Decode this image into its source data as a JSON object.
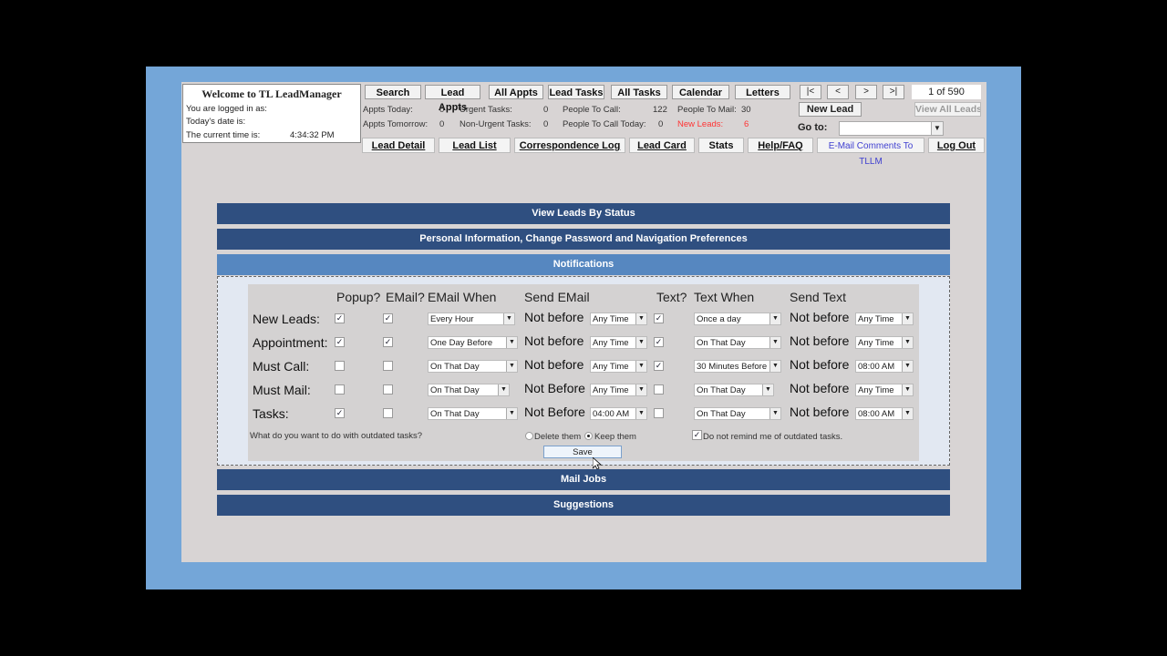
{
  "welcome": {
    "title": "Welcome to TL LeadManager",
    "logged_in_label": "You are logged in as:",
    "date_label": "Today's date is:",
    "time_label": "The current time is:",
    "time_value": "4:34:32 PM"
  },
  "top_nav": {
    "search": "Search",
    "lead_appts": "Lead Appts",
    "all_appts": "All Appts",
    "lead_tasks": "Lead Tasks",
    "all_tasks": "All Tasks",
    "calendar": "Calendar",
    "letters": "Letters",
    "first": "|<",
    "prev": "<",
    "next": ">",
    "last": ">|",
    "pager": "1 of 590",
    "new_lead": "New Lead",
    "view_all_leads": "View All Leads",
    "goto_label": "Go to:"
  },
  "stats": {
    "appts_today_label": "Appts Today:",
    "appts_today": "0",
    "urgent_tasks_label": "Urgent Tasks:",
    "urgent_tasks": "0",
    "people_to_call_label": "People To Call:",
    "people_to_call": "122",
    "people_to_mail_label": "People To Mail:",
    "people_to_mail": "30",
    "appts_tomorrow_label": "Appts Tomorrow:",
    "appts_tomorrow": "0",
    "non_urgent_tasks_label": "Non-Urgent Tasks:",
    "non_urgent_tasks": "0",
    "people_to_call_today_label": "People To Call Today:",
    "people_to_call_today": "0",
    "new_leads_label": "New Leads:",
    "new_leads": "6",
    "new_leads_color": "#ff3333"
  },
  "tabs2": {
    "lead_detail": "Lead Detail",
    "lead_list": "Lead List",
    "correspondence_log": "Correspondence Log",
    "lead_card": "Lead Card",
    "stats": "Stats",
    "help_faq": "Help/FAQ",
    "email_comments": "E-Mail Comments To TLLM",
    "log_out": "Log Out"
  },
  "sections": {
    "view_leads_by_status": "View Leads By Status",
    "personal_info": "Personal Information, Change Password and Navigation Preferences",
    "notifications": "Notifications",
    "mail_jobs": "Mail Jobs",
    "suggestions": "Suggestions"
  },
  "notifications": {
    "headers": {
      "popup": "Popup?",
      "email": "EMail?",
      "email_when": "EMail When",
      "send_email": "Send EMail",
      "text": "Text?",
      "text_when": "Text When",
      "send_text": "Send Text"
    },
    "rows": [
      {
        "label": "New Leads:",
        "popup": true,
        "email": true,
        "email_when": "Every Hour",
        "email_nb": "Not before",
        "email_time": "Any Time",
        "text": true,
        "text_when": "Once a day",
        "text_nb": "Not before",
        "text_time": "Any Time"
      },
      {
        "label": "Appointment:",
        "popup": true,
        "email": true,
        "email_when": "One Day Before",
        "email_nb": "Not before",
        "email_time": "Any Time",
        "text": true,
        "text_when": "On That Day",
        "text_nb": "Not before",
        "text_time": "Any Time"
      },
      {
        "label": "Must Call:",
        "popup": false,
        "email": false,
        "email_when": "On That Day",
        "email_nb": "Not before",
        "email_time": "Any Time",
        "text": true,
        "text_when": "30 Minutes Before",
        "text_nb": "Not before",
        "text_time": "08:00 AM"
      },
      {
        "label": "Must Mail:",
        "popup": false,
        "email": false,
        "email_when": "On That Day",
        "email_nb": "Not Before",
        "email_time": "Any Time",
        "text": false,
        "text_when": "On That Day",
        "text_nb": "Not before",
        "text_time": "Any Time"
      },
      {
        "label": "Tasks:",
        "popup": true,
        "email": false,
        "email_when": "On That Day",
        "email_nb": "Not Before",
        "email_time": "04:00 AM",
        "text": false,
        "text_when": "On That Day",
        "text_nb": "Not before",
        "text_time": "08:00 AM"
      }
    ],
    "outdated_question": "What do you want to do with outdated tasks?",
    "delete_them": "Delete them",
    "keep_them": "Keep them",
    "keep_selected": true,
    "do_not_remind": "Do not remind me of outdated tasks.",
    "do_not_remind_checked": true,
    "save": "Save"
  },
  "colors": {
    "frame": "#74a6d8",
    "section_bar": "#2f4f80",
    "section_bar_active": "#5687c0",
    "app_bg": "#d8d4d4"
  }
}
